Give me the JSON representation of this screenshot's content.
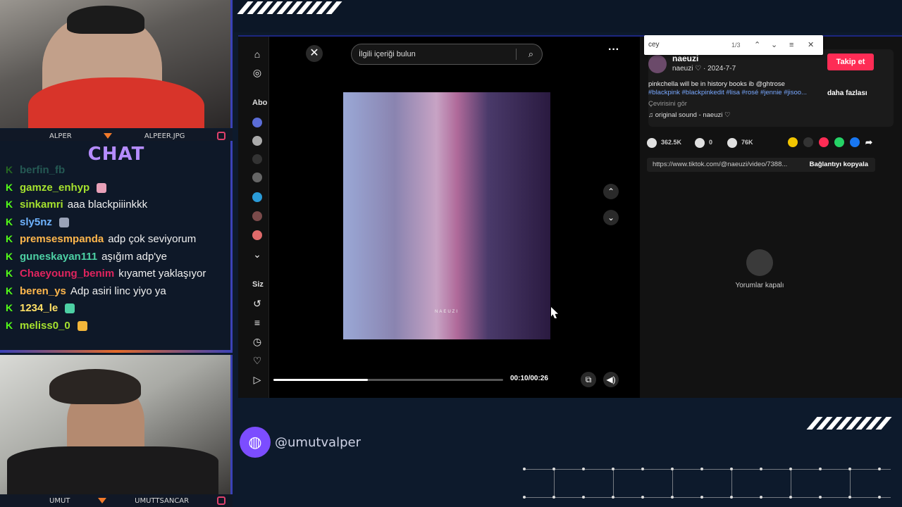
{
  "cams": {
    "top_names": [
      "ALPER",
      "ALPEER.JPG"
    ],
    "bottom_names": [
      "UMUT",
      "UMUTTSANCAR"
    ]
  },
  "chat": {
    "title": "CHAT",
    "cut_user": "berfin_fb",
    "messages": [
      {
        "user": "gamze_enhyp",
        "text": "",
        "color": "#a6e22e"
      },
      {
        "user": "sinkamri",
        "text": "aaa blackpiiinkkk",
        "color": "#a6e22e"
      },
      {
        "user": "sly5nz",
        "text": "",
        "color": "#6fb3ff"
      },
      {
        "user": "premsesmpanda",
        "text": "adp çok seviyorum",
        "color": "#ffb74d"
      },
      {
        "user": "guneskayan111",
        "text": "aşığım adp'ye",
        "color": "#4dd0a4"
      },
      {
        "user": "Chaeyoung_benim",
        "text": "kıyamet yaklaşıyor",
        "color": "#e0245e"
      },
      {
        "user": "beren_ys",
        "text": "Adp asiri linc yiyo ya",
        "color": "#ffb74d"
      },
      {
        "user": "1234_le",
        "text": "",
        "color": "#ffe066"
      },
      {
        "user": "meliss0_0",
        "text": "",
        "color": "#a6e22e"
      }
    ]
  },
  "browser": {
    "nav_labels": [
      "Abo",
      "Siz"
    ],
    "search_placeholder": "İlgili içeriği bulun",
    "video_watermark": "NAEUZI",
    "time": "00:10/00:26",
    "progress": 0.41,
    "find": {
      "query": "cey",
      "count": "1/3"
    },
    "post": {
      "username": "naeuzi",
      "meta": "naeuzi ♡ · 2024-7-7",
      "follow_label": "Takip et",
      "caption": "pinkchella will be in history books ib @ghtrose",
      "hashtags": "#blackpink #blackpinkedit #lisa #rosé #jennie #jisoo...",
      "more_label": "daha fazlası",
      "translate_label": "Çevirisini gör",
      "sound": "original sound - naeuzi ♡",
      "likes": "362.5K",
      "comments": "0",
      "saves": "76K",
      "url": "https://www.tiktok.com/@naeuzi/video/7388...",
      "copy_label": "Bağlantıyı kopyala",
      "comments_off": "Yorumlar kapalı"
    }
  },
  "footer": {
    "handle": "@umutvalper"
  },
  "colors": {
    "accent": "#3b42b8",
    "follow": "#fe2c55",
    "chat_title": "#b58cff",
    "kick_green": "#53fc18"
  }
}
